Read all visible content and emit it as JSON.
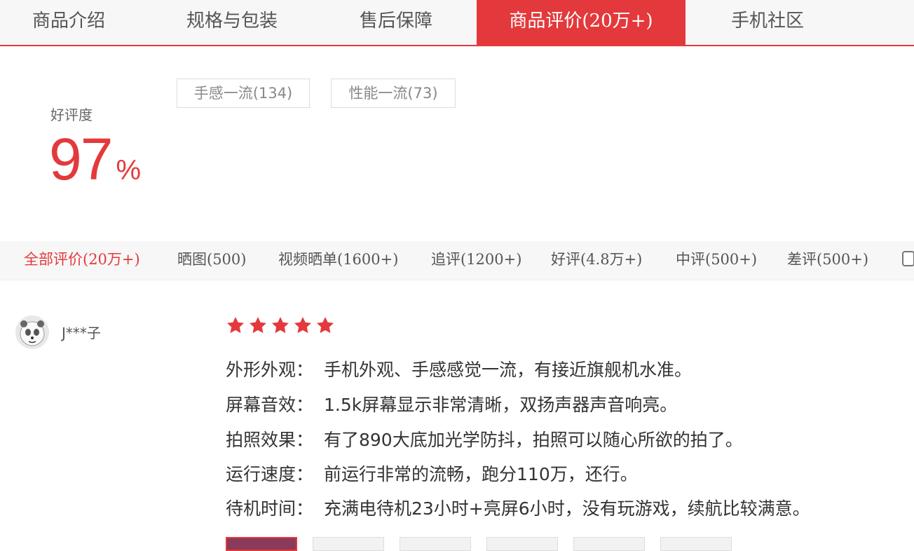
{
  "tabs": [
    {
      "label": "商品介绍"
    },
    {
      "label": "规格与包装"
    },
    {
      "label": "售后保障"
    },
    {
      "label": "商品评价(20万+)",
      "active": true
    },
    {
      "label": "手机社区"
    }
  ],
  "summary": {
    "label": "好评度",
    "value": "97",
    "unit": "%"
  },
  "tags": [
    {
      "label": "手感一流(134)"
    },
    {
      "label": "性能一流(73)"
    }
  ],
  "filters": [
    {
      "label": "全部评价(20万+)",
      "active": true
    },
    {
      "label": "晒图(500)"
    },
    {
      "label": "视频晒单(1600+)"
    },
    {
      "label": "追评(1200+)"
    },
    {
      "label": "好评(4.8万+)"
    },
    {
      "label": "中评(500+)"
    },
    {
      "label": "差评(500+)"
    }
  ],
  "review": {
    "username": "J***子",
    "stars": 5,
    "lines": [
      {
        "label": "外形外观：",
        "text": "手机外观、手感感觉一流，有接近旗舰机水准。"
      },
      {
        "label": "屏幕音效：",
        "text": "1.5k屏幕显示非常清晰，双扬声器声音响亮。"
      },
      {
        "label": "拍照效果：",
        "text": "有了890大底加光学防抖，拍照可以随心所欲的拍了。"
      },
      {
        "label": "运行速度：",
        "text": "前运行非常的流畅，跑分110万，还行。"
      },
      {
        "label": "待机时间：",
        "text": "充满电待机23小时+亮屏6小时，没有玩游戏，续航比较满意。"
      }
    ]
  },
  "colors": {
    "accent": "#e4393c",
    "star": "#e4393c"
  }
}
